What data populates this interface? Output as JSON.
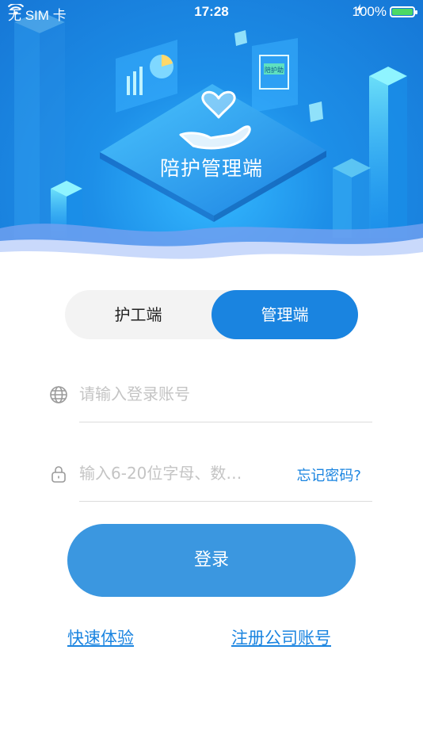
{
  "status_bar": {
    "carrier": "无 SIM 卡",
    "time": "17:28",
    "battery_percent": "100%",
    "battery_level": 1.0
  },
  "header": {
    "app_title": "陪护管理端",
    "chip_label": "陪护助"
  },
  "role_switch": {
    "options": [
      "护工端",
      "管理端"
    ],
    "selected": "管理端"
  },
  "account_field": {
    "placeholder": "请输入登录账号",
    "value": "",
    "icon": "globe-icon"
  },
  "password_field": {
    "placeholder": "输入6-20位字母、数…",
    "value": "",
    "icon": "lock-icon",
    "forgot_label": "忘记密码?"
  },
  "login_button": {
    "label": "登录"
  },
  "links": {
    "quick_trial": "快速体验",
    "register_company": "注册公司账号"
  },
  "colors": {
    "accent": "#1a84e0",
    "button": "#3b97e0",
    "hero_blue": "#1d8fe8"
  }
}
